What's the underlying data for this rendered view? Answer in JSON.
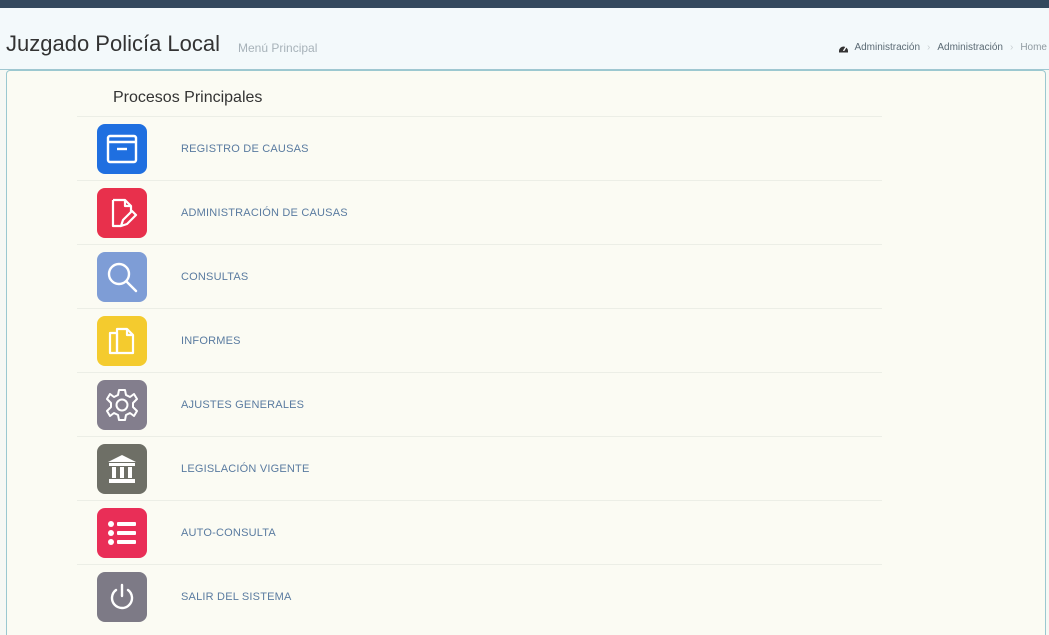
{
  "header": {
    "title": "Juzgado Policía Local",
    "subtitle": "Menú Principal",
    "breadcrumb": [
      "Administración",
      "Administración",
      "Home"
    ]
  },
  "section": {
    "title": "Procesos Principales"
  },
  "menu": [
    {
      "label": "REGISTRO DE CAUSAS",
      "icon": "archive-box-icon",
      "color": "#1f6fe0"
    },
    {
      "label": "ADMINISTRACIÓN DE CAUSAS",
      "icon": "edit-document-icon",
      "color": "#e8304c"
    },
    {
      "label": "CONSULTAS",
      "icon": "search-icon",
      "color": "#7e9dd6"
    },
    {
      "label": "INFORMES",
      "icon": "documents-icon",
      "color": "#f4cb2e"
    },
    {
      "label": "AJUSTES GENERALES",
      "icon": "gear-icon",
      "color": "#837e8d"
    },
    {
      "label": "LEGISLACIÓN VIGENTE",
      "icon": "courthouse-icon",
      "color": "#6e6f66"
    },
    {
      "label": "AUTO-CONSULTA",
      "icon": "list-icon",
      "color": "#e92e57"
    },
    {
      "label": "SALIR DEL SISTEMA",
      "icon": "power-icon",
      "color": "#7d7a86"
    }
  ],
  "colors": {
    "topbar": "#34495e",
    "header_bg": "#f3f9fb",
    "panel_bg": "#fbfbf3",
    "panel_border": "#9bc8d0",
    "label_text": "#5a7ba0"
  }
}
